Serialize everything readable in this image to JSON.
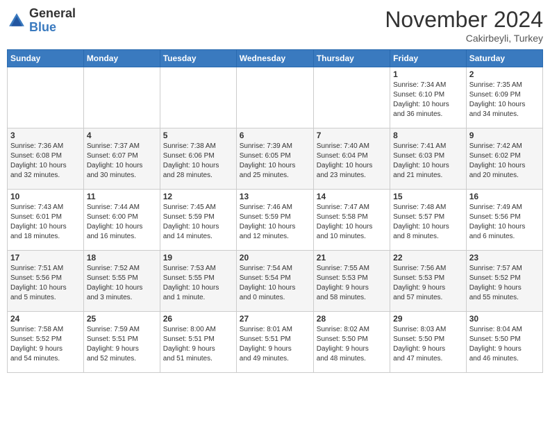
{
  "header": {
    "logo_general": "General",
    "logo_blue": "Blue",
    "month_title": "November 2024",
    "subtitle": "Cakirbeyli, Turkey"
  },
  "weekdays": [
    "Sunday",
    "Monday",
    "Tuesday",
    "Wednesday",
    "Thursday",
    "Friday",
    "Saturday"
  ],
  "weeks": [
    [
      {
        "day": "",
        "info": ""
      },
      {
        "day": "",
        "info": ""
      },
      {
        "day": "",
        "info": ""
      },
      {
        "day": "",
        "info": ""
      },
      {
        "day": "",
        "info": ""
      },
      {
        "day": "1",
        "info": "Sunrise: 7:34 AM\nSunset: 6:10 PM\nDaylight: 10 hours\nand 36 minutes."
      },
      {
        "day": "2",
        "info": "Sunrise: 7:35 AM\nSunset: 6:09 PM\nDaylight: 10 hours\nand 34 minutes."
      }
    ],
    [
      {
        "day": "3",
        "info": "Sunrise: 7:36 AM\nSunset: 6:08 PM\nDaylight: 10 hours\nand 32 minutes."
      },
      {
        "day": "4",
        "info": "Sunrise: 7:37 AM\nSunset: 6:07 PM\nDaylight: 10 hours\nand 30 minutes."
      },
      {
        "day": "5",
        "info": "Sunrise: 7:38 AM\nSunset: 6:06 PM\nDaylight: 10 hours\nand 28 minutes."
      },
      {
        "day": "6",
        "info": "Sunrise: 7:39 AM\nSunset: 6:05 PM\nDaylight: 10 hours\nand 25 minutes."
      },
      {
        "day": "7",
        "info": "Sunrise: 7:40 AM\nSunset: 6:04 PM\nDaylight: 10 hours\nand 23 minutes."
      },
      {
        "day": "8",
        "info": "Sunrise: 7:41 AM\nSunset: 6:03 PM\nDaylight: 10 hours\nand 21 minutes."
      },
      {
        "day": "9",
        "info": "Sunrise: 7:42 AM\nSunset: 6:02 PM\nDaylight: 10 hours\nand 20 minutes."
      }
    ],
    [
      {
        "day": "10",
        "info": "Sunrise: 7:43 AM\nSunset: 6:01 PM\nDaylight: 10 hours\nand 18 minutes."
      },
      {
        "day": "11",
        "info": "Sunrise: 7:44 AM\nSunset: 6:00 PM\nDaylight: 10 hours\nand 16 minutes."
      },
      {
        "day": "12",
        "info": "Sunrise: 7:45 AM\nSunset: 5:59 PM\nDaylight: 10 hours\nand 14 minutes."
      },
      {
        "day": "13",
        "info": "Sunrise: 7:46 AM\nSunset: 5:59 PM\nDaylight: 10 hours\nand 12 minutes."
      },
      {
        "day": "14",
        "info": "Sunrise: 7:47 AM\nSunset: 5:58 PM\nDaylight: 10 hours\nand 10 minutes."
      },
      {
        "day": "15",
        "info": "Sunrise: 7:48 AM\nSunset: 5:57 PM\nDaylight: 10 hours\nand 8 minutes."
      },
      {
        "day": "16",
        "info": "Sunrise: 7:49 AM\nSunset: 5:56 PM\nDaylight: 10 hours\nand 6 minutes."
      }
    ],
    [
      {
        "day": "17",
        "info": "Sunrise: 7:51 AM\nSunset: 5:56 PM\nDaylight: 10 hours\nand 5 minutes."
      },
      {
        "day": "18",
        "info": "Sunrise: 7:52 AM\nSunset: 5:55 PM\nDaylight: 10 hours\nand 3 minutes."
      },
      {
        "day": "19",
        "info": "Sunrise: 7:53 AM\nSunset: 5:55 PM\nDaylight: 10 hours\nand 1 minute."
      },
      {
        "day": "20",
        "info": "Sunrise: 7:54 AM\nSunset: 5:54 PM\nDaylight: 10 hours\nand 0 minutes."
      },
      {
        "day": "21",
        "info": "Sunrise: 7:55 AM\nSunset: 5:53 PM\nDaylight: 9 hours\nand 58 minutes."
      },
      {
        "day": "22",
        "info": "Sunrise: 7:56 AM\nSunset: 5:53 PM\nDaylight: 9 hours\nand 57 minutes."
      },
      {
        "day": "23",
        "info": "Sunrise: 7:57 AM\nSunset: 5:52 PM\nDaylight: 9 hours\nand 55 minutes."
      }
    ],
    [
      {
        "day": "24",
        "info": "Sunrise: 7:58 AM\nSunset: 5:52 PM\nDaylight: 9 hours\nand 54 minutes."
      },
      {
        "day": "25",
        "info": "Sunrise: 7:59 AM\nSunset: 5:51 PM\nDaylight: 9 hours\nand 52 minutes."
      },
      {
        "day": "26",
        "info": "Sunrise: 8:00 AM\nSunset: 5:51 PM\nDaylight: 9 hours\nand 51 minutes."
      },
      {
        "day": "27",
        "info": "Sunrise: 8:01 AM\nSunset: 5:51 PM\nDaylight: 9 hours\nand 49 minutes."
      },
      {
        "day": "28",
        "info": "Sunrise: 8:02 AM\nSunset: 5:50 PM\nDaylight: 9 hours\nand 48 minutes."
      },
      {
        "day": "29",
        "info": "Sunrise: 8:03 AM\nSunset: 5:50 PM\nDaylight: 9 hours\nand 47 minutes."
      },
      {
        "day": "30",
        "info": "Sunrise: 8:04 AM\nSunset: 5:50 PM\nDaylight: 9 hours\nand 46 minutes."
      }
    ]
  ]
}
